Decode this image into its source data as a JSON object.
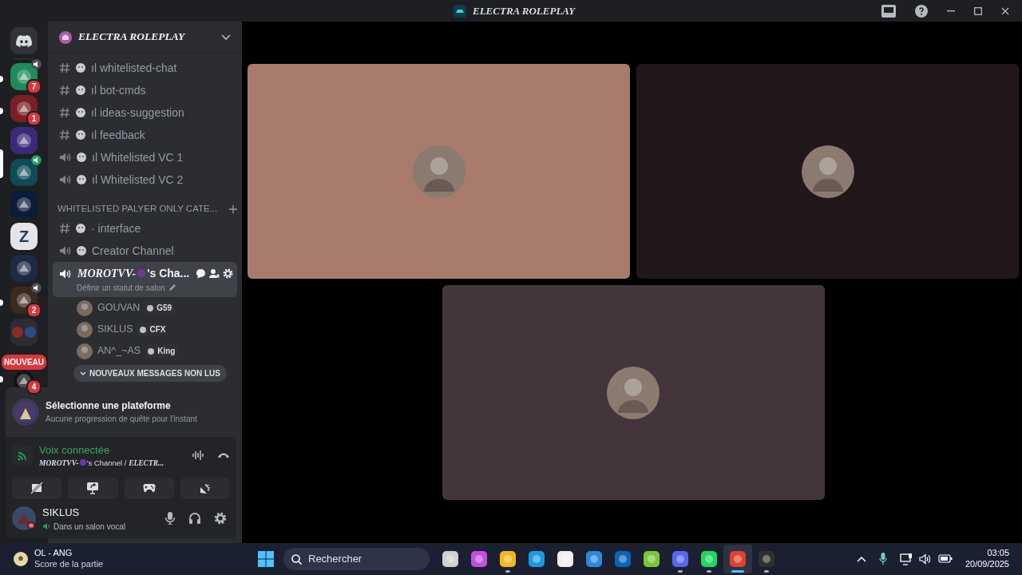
{
  "window": {
    "title": "ELECTRA ROLEPLAY"
  },
  "servers": [
    {
      "color": "#1f8a5a",
      "badge": "7",
      "voice": true,
      "unread": true,
      "selected": false
    },
    {
      "color": "#7a1f22",
      "badge": "1",
      "voice": false,
      "unread": true,
      "selected": false
    },
    {
      "color": "#3b2a7a",
      "voice": false,
      "unread": false,
      "selected": false
    },
    {
      "color": "#0f4a55",
      "voice": true,
      "unread": false,
      "selected": true
    },
    {
      "color": "#0d1a3a",
      "voice": false,
      "unread": false,
      "selected": false
    },
    {
      "color": "#e3e5e8",
      "letter": "Z",
      "voice": false,
      "unread": false,
      "selected": false
    },
    {
      "color": "#1e2a44",
      "voice": false,
      "unread": false,
      "selected": false
    },
    {
      "color": "#3a2a20",
      "badge": "2",
      "voice": true,
      "unread": true,
      "selected": false
    },
    {
      "color": "#2b2d31",
      "kind": "folder",
      "voice": false,
      "unread": false,
      "selected": false
    },
    {
      "color": "#111111",
      "badge": "4",
      "ribbon": "NOUVEAU",
      "voice": false,
      "unread": true,
      "selected": false
    }
  ],
  "server_name": "ELECTRA ROLEPLAY",
  "channels": [
    {
      "kind": "text",
      "prefix": "ıl",
      "name": "whitelisted-chat"
    },
    {
      "kind": "text",
      "prefix": "ıl",
      "name": "bot-cmds"
    },
    {
      "kind": "text",
      "prefix": "ıl",
      "name": "ideas-suggestion"
    },
    {
      "kind": "text",
      "prefix": "ıl",
      "name": "feedback"
    },
    {
      "kind": "voice",
      "prefix": "ıl",
      "name": "Whitelisted VC 1"
    },
    {
      "kind": "voice",
      "prefix": "ıl",
      "name": "Whitelisted VC 2"
    },
    {
      "kind": "category",
      "name": "WHITELISTED PALYER ONLY CATE..."
    },
    {
      "kind": "text",
      "prefix": "·",
      "name": "interface"
    },
    {
      "kind": "voice",
      "name": "Creator Channel"
    },
    {
      "kind": "active_voice",
      "name": "MOROTVV-",
      "suffix": "'s Cha...",
      "status": "Définir un statut de salon",
      "members": [
        {
          "name": "GOUVAN",
          "tag": "G59"
        },
        {
          "name": "SIKLUS",
          "tag": "CFX"
        },
        {
          "name": "AN^_~AS",
          "tag": "King"
        }
      ]
    }
  ],
  "new_messages": "NOUVEAUX MESSAGES NON LUS",
  "quest": {
    "title": "Sélectionne une plateforme",
    "subtitle": "Aucune progression de quête pour l'instant"
  },
  "voice": {
    "status": "Voix connectée",
    "channel_name": "MOROTVV-",
    "channel_rest": "'s Channel / ",
    "server_part": "ELECTR..."
  },
  "user": {
    "name": "SIKLUS",
    "status": "Dans un salon vocal"
  },
  "tiles": [
    {
      "color": "#a87b6c"
    },
    {
      "color": "#21171b"
    },
    {
      "color": "#433539"
    }
  ],
  "taskbar": {
    "widget_title": "OL - ANG",
    "widget_subtitle": "Score de la partie",
    "search": "Rechercher",
    "apps": [
      {
        "color": "#d0d0d0",
        "running": false,
        "selected": false
      },
      {
        "color": "#c050e0",
        "running": false,
        "selected": false
      },
      {
        "color": "#f0b820",
        "running": true,
        "selected": false
      },
      {
        "color": "#1a9be0",
        "running": false,
        "selected": false
      },
      {
        "color": "#f0f0f0",
        "running": false,
        "selected": false
      },
      {
        "color": "#2a8ad8",
        "running": false,
        "selected": false
      },
      {
        "color": "#0a64b8",
        "running": false,
        "selected": false
      },
      {
        "color": "#7ac83a",
        "running": false,
        "selected": false
      },
      {
        "color": "#5865f2",
        "running": true,
        "selected": false
      },
      {
        "color": "#1ed760",
        "running": true,
        "selected": false
      },
      {
        "color": "#e04030",
        "running": true,
        "selected": true
      },
      {
        "color": "#303030",
        "running": true,
        "selected": false
      }
    ],
    "time": "03:05",
    "date": "20/09/2025"
  }
}
